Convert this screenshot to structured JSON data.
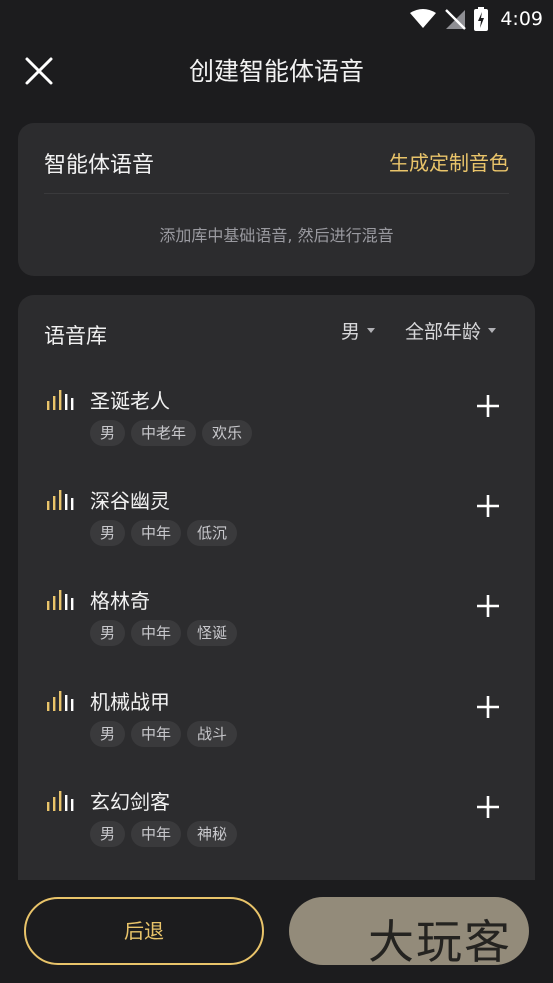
{
  "status_bar": {
    "time": "4:09"
  },
  "header": {
    "title": "创建智能体语音"
  },
  "agent_voice": {
    "title": "智能体语音",
    "custom_link": "生成定制音色",
    "hint": "添加库中基础语音, 然后进行混音"
  },
  "library": {
    "title": "语音库",
    "filters": {
      "gender": "男",
      "age": "全部年龄"
    },
    "items": [
      {
        "name": "圣诞老人",
        "tags": [
          "男",
          "中老年",
          "欢乐"
        ]
      },
      {
        "name": "深谷幽灵",
        "tags": [
          "男",
          "中年",
          "低沉"
        ]
      },
      {
        "name": "格林奇",
        "tags": [
          "男",
          "中年",
          "怪诞"
        ]
      },
      {
        "name": "机械战甲",
        "tags": [
          "男",
          "中年",
          "战斗"
        ]
      },
      {
        "name": "玄幻剑客",
        "tags": [
          "男",
          "中年",
          "神秘"
        ]
      }
    ]
  },
  "footer": {
    "back_label": "后退",
    "watermark": "大玩客"
  },
  "colors": {
    "accent": "#e9c46a",
    "background": "#1c1c1e",
    "card": "#2c2c2e"
  }
}
